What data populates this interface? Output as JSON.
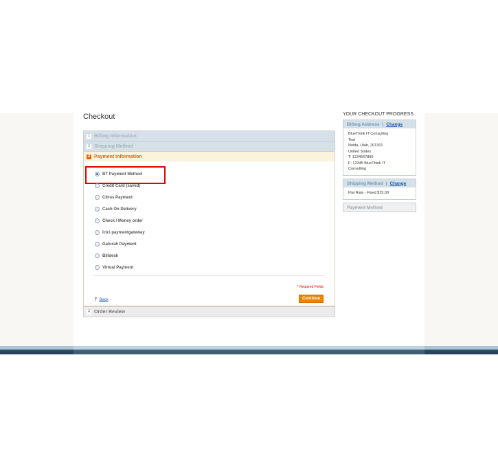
{
  "checkout": {
    "title": "Checkout",
    "steps": [
      {
        "num": "1",
        "label": "Billing Information"
      },
      {
        "num": "2",
        "label": "Shipping Method"
      },
      {
        "num": "3",
        "label": "Payment Information"
      },
      {
        "num": "4",
        "label": "Order Review"
      }
    ],
    "payment_methods": [
      "BT Payment Method",
      "Credit Card (saved)",
      "Citrus Payment",
      "Cash On Delivery",
      "Check / Money order",
      "Icici paymentgateway",
      "Gaturah Payment",
      "Billdesk",
      "Virtual Payment"
    ],
    "selected_method": "BT Payment Method",
    "required_note": "* Required Fields",
    "back_label": "Back",
    "continue_label": "Continue"
  },
  "progress": {
    "title": "YOUR CHECKOUT PROGRESS",
    "billing": {
      "title": "Billing Address",
      "change": "Change",
      "lines": [
        "BlueThink IT Consulting",
        "Test",
        "Noida, Utah, 201301",
        "United States",
        "T: 1234567890",
        "F: 12345 BlueThink IT",
        "Consulting"
      ]
    },
    "shipping": {
      "title": "Shipping Method",
      "change": "Change",
      "value": "Flat Rate - Fixed $15.00"
    },
    "payment": {
      "title": "Payment Method"
    }
  },
  "colors": {
    "accent": "#f18200",
    "link": "#1e5fa8",
    "highlight": "#e00000"
  }
}
